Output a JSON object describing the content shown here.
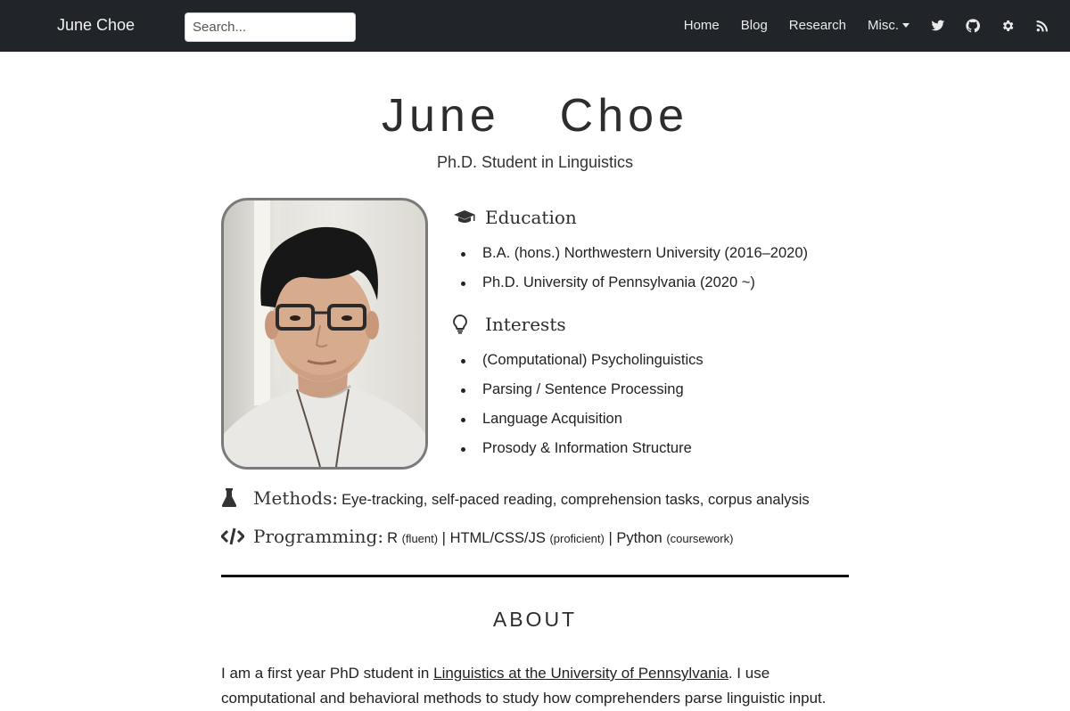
{
  "navbar": {
    "brand": "June Choe",
    "search_placeholder": "Search...",
    "links": [
      "Home",
      "Blog",
      "Research",
      "Misc."
    ],
    "icons": [
      "twitter-icon",
      "github-icon",
      "cog-icon",
      "rss-icon"
    ]
  },
  "hero": {
    "name": "June  Choe",
    "subtitle": "Ph.D. Student in Linguistics"
  },
  "education": {
    "heading": "Education",
    "items": [
      "B.A. (hons.) Northwestern University (2016–2020)",
      "Ph.D. University of Pennsylvania (2020 ~)"
    ]
  },
  "interests": {
    "heading": "Interests",
    "items": [
      "(Computational) Psycholinguistics",
      "Parsing / Sentence Processing",
      "Language Acquisition",
      "Prosody & Information Structure"
    ]
  },
  "methods": {
    "label": "Methods:",
    "text": "Eye-tracking, self-paced reading, comprehension tasks, corpus analysis"
  },
  "programming": {
    "label": "Programming:",
    "r": "R",
    "r_level": "(fluent)",
    "sep1": "|",
    "web": "HTML/CSS/JS",
    "web_level": "(proficient)",
    "sep2": "|",
    "python": "Python",
    "python_level": "(coursework)"
  },
  "about": {
    "heading": "ABOUT",
    "text_before": "I am a first year PhD student in ",
    "link": "Linguistics at the University of Pennsylvania",
    "text_after": ". I use computational and behavioral methods to study how comprehenders parse linguistic input."
  },
  "colors": {
    "navbar_bg": "#212529",
    "text": "#222222",
    "photo_border": "#7a7a7a"
  }
}
